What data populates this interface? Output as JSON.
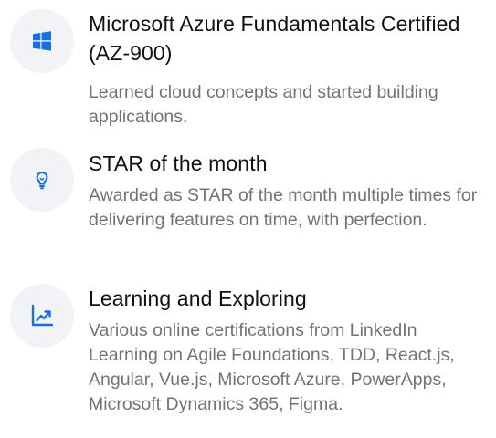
{
  "theme": {
    "accent": "#1a6fe0",
    "icon_background": "#f1f3f6",
    "title_color": "#111111",
    "description_color": "#6f7479"
  },
  "achievements": [
    {
      "icon": "windows-icon",
      "title": "Microsoft Azure Fundamentals Certified (AZ-900)",
      "description": "Learned cloud concepts and started building applications."
    },
    {
      "icon": "lightbulb-icon",
      "title": "STAR of the month",
      "description": "Awarded as STAR of the month multiple times for delivering features on time, with perfection."
    },
    {
      "icon": "trending-up-icon",
      "title": "Learning and Exploring",
      "description": "Various online certifications from LinkedIn Learning on Agile Foundations, TDD, React.js, Angular, Vue.js, Microsoft Azure, PowerApps, Microsoft Dynamics 365, Figma."
    }
  ]
}
